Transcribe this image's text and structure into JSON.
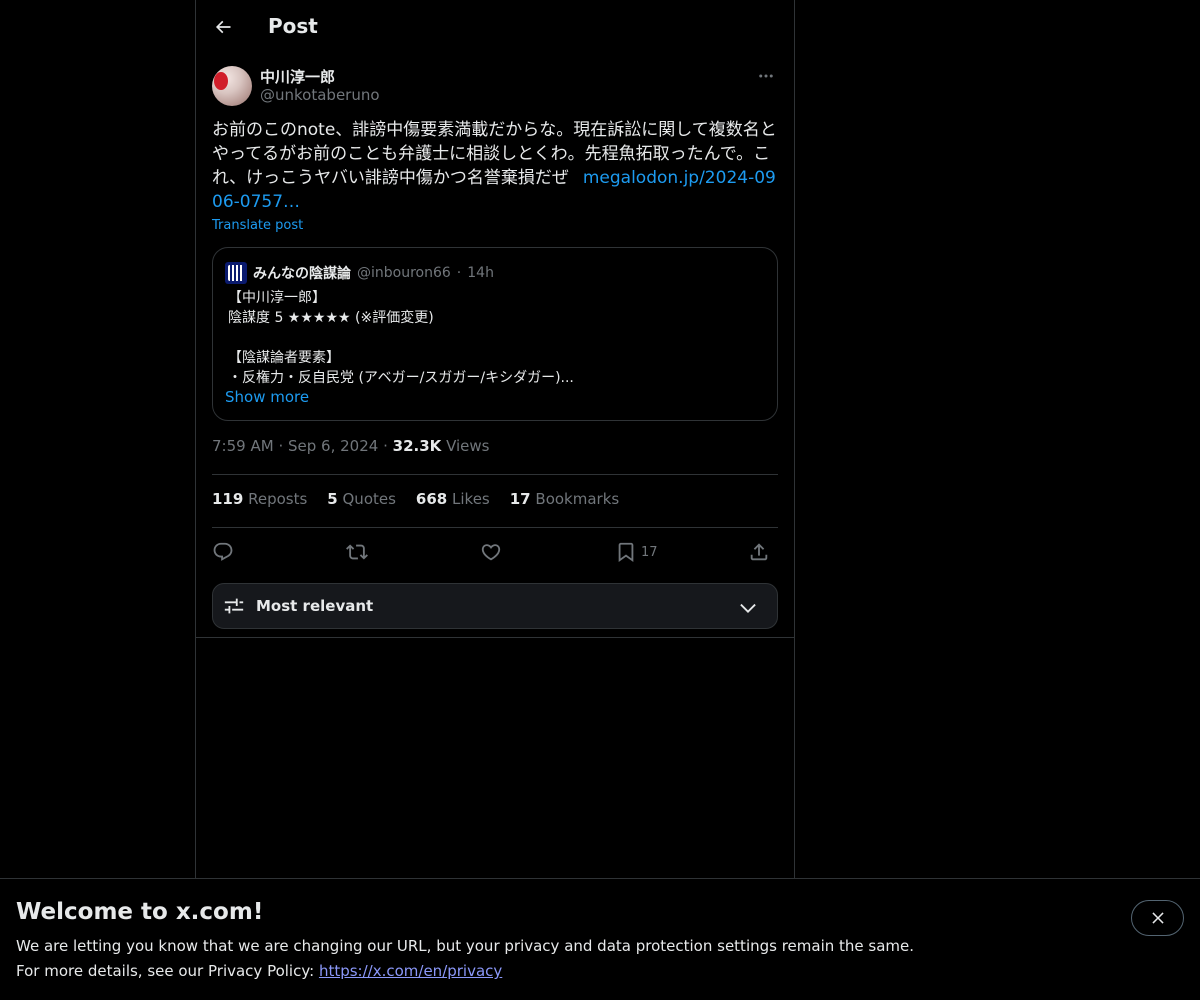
{
  "header": {
    "title": "Post"
  },
  "post": {
    "author_name": "中川淳一郎",
    "author_handle": "@unkotaberuno",
    "text": "お前のこのnote、誹謗中傷要素満載だからな。現在訴訟に関して複数名とやってるがお前のことも弁護士に相談しとくわ。先程魚拓取ったんで。これ、けっこうヤバい誹謗中傷かつ名誉棄損だぜ",
    "link_text": "megalodon.jp/2024-0906-0757…",
    "translate_label": "Translate post",
    "time": "7:59 AM",
    "date": "Sep 6, 2024",
    "views_count": "32.3K",
    "views_label": "Views",
    "dot": "·"
  },
  "quote": {
    "name": "みんなの陰謀論",
    "handle": "@inbouron66",
    "dot": "·",
    "time": "14h",
    "lines": [
      "【中川淳一郎】",
      "陰謀度 5 ★★★★★ (※評価変更)",
      "",
      "【陰謀論者要素】",
      "・反権力・反自民党 (アベガー/スガガー/キシダガー)..."
    ],
    "show_more": "Show more"
  },
  "stats": {
    "reposts_count": "119",
    "reposts_label": "Reposts",
    "quotes_count": "5",
    "quotes_label": "Quotes",
    "likes_count": "668",
    "likes_label": "Likes",
    "bookmarks_count": "17",
    "bookmarks_label": "Bookmarks"
  },
  "actions": {
    "bookmark_count": "17"
  },
  "sort": {
    "label": "Most relevant"
  },
  "banner": {
    "title": "Welcome to x.com!",
    "line1": "We are letting you know that we are changing our URL, but your privacy and data protection settings remain the same.",
    "line2_prefix": "For more details, see our Privacy Policy: ",
    "link": "https://x.com/en/privacy"
  },
  "colors": {
    "background": "#000000",
    "accent": "#1d9bf0",
    "border": "#2f3336",
    "muted": "#71767b"
  },
  "icons": [
    "back-arrow-icon",
    "more-icon",
    "reply-icon",
    "repost-icon",
    "like-icon",
    "bookmark-icon",
    "share-icon",
    "sort-sliders-icon",
    "chevron-down-icon",
    "close-icon"
  ]
}
